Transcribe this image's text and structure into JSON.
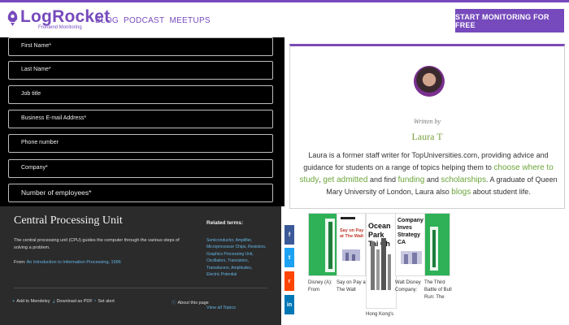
{
  "header": {
    "logo_text": "LogRocket",
    "logo_tagline": "Frontend Monitoring",
    "nav": [
      "BLOG",
      "PODCAST",
      "MEETUPS"
    ],
    "cta_label": "START MONITORING FOR FREE",
    "brand_color": "#764abc"
  },
  "form": {
    "fields": [
      "First Name*",
      "Last Name*",
      "Job title",
      "Business E-mail Address*",
      "Phone number",
      "Company*",
      "Number of employees*"
    ]
  },
  "author": {
    "written_by": "Written by",
    "name": "Laura T",
    "bio_1": "Laura is a former staff writer for TopUniversities.com, providing advice and guidance for students on a range of topics helping them to",
    "link_1": "choose where to study",
    "sep_1": ",",
    "link_2": "get admitted",
    "bio_2": "and find",
    "link_3": "funding",
    "bio_3": "and",
    "link_4": "scholarships",
    "bio_4": ". A graduate of Queen Mary University of London, Laura also",
    "link_5": "blogs",
    "bio_5": "about student life.",
    "link_color": "#6ba53a"
  },
  "article": {
    "title": "Central Processing Unit",
    "body": "The central processing unit (CPU) guides the computer through the various steps of solving a problem.",
    "from_label": "From:",
    "from_link": "An Introduction to Information Processing, 1996",
    "actions": {
      "add": "Add to Mendeley",
      "download": "Download as PDF",
      "alert": "Set alert",
      "about": "About this page"
    },
    "related_title": "Related terms:",
    "related_terms": "Semiconductor, Amplifier, Microprocessor Chips, Resistors, Graphics Processing Unit, Oscillators, Transistors, Transducers, Amplitudes, Electric Potential",
    "view_all": "View all Topics"
  },
  "share": {
    "icons": [
      "facebook-icon",
      "twitter-icon",
      "reddit-icon",
      "linkedin-icon"
    ],
    "glyphs": [
      "f",
      "t",
      "r",
      "in"
    ],
    "colors": [
      "#3b5998",
      "#1da1f2",
      "#ff4500",
      "#0077b5"
    ]
  },
  "books": [
    {
      "cover_title": "",
      "label": "Disney (A): From"
    },
    {
      "cover_title": "Say on Pay at The Walt",
      "label": "Say on Pay at The Walt"
    },
    {
      "cover_title": "Ocean Park Tai Ch",
      "label": "Hong Kong's"
    },
    {
      "cover_title": "Company Inves Strategy CA",
      "label": "Walt Disney Company:"
    },
    {
      "cover_title": "",
      "label": "The Third Battle of Bull Run: The"
    }
  ]
}
